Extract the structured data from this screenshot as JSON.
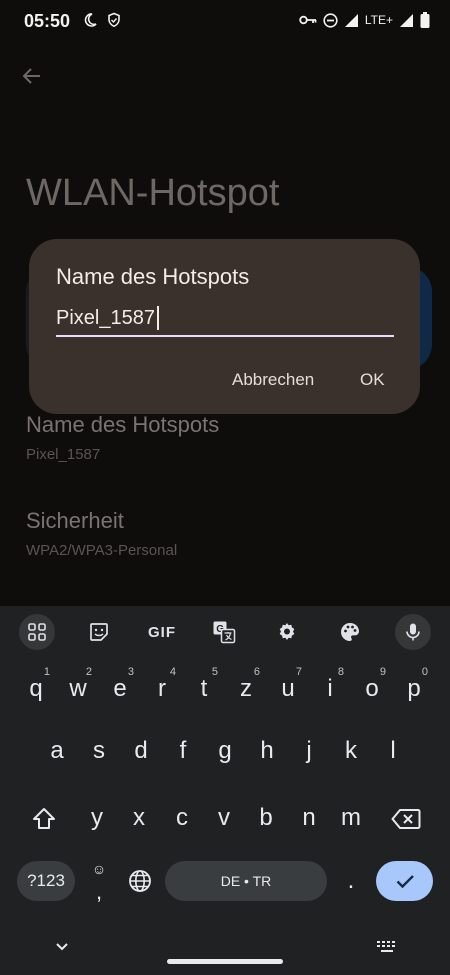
{
  "status": {
    "time": "05:50",
    "network": "LTE+"
  },
  "page": {
    "title": "WLAN-Hotspot",
    "settings": [
      {
        "title": "Name des Hotspots",
        "subtitle": "Pixel_1587"
      },
      {
        "title": "Sicherheit",
        "subtitle": "WPA2/WPA3-Personal"
      }
    ]
  },
  "dialog": {
    "title": "Name des Hotspots",
    "input_value": "Pixel_1587",
    "cancel_label": "Abbrechen",
    "ok_label": "OK"
  },
  "keyboard": {
    "toolbar": {
      "gif_label": "GIF"
    },
    "row1": [
      {
        "label": "q",
        "hint": "1"
      },
      {
        "label": "w",
        "hint": "2"
      },
      {
        "label": "e",
        "hint": "3"
      },
      {
        "label": "r",
        "hint": "4"
      },
      {
        "label": "t",
        "hint": "5"
      },
      {
        "label": "z",
        "hint": "6"
      },
      {
        "label": "u",
        "hint": "7"
      },
      {
        "label": "i",
        "hint": "8"
      },
      {
        "label": "o",
        "hint": "9"
      },
      {
        "label": "p",
        "hint": "0"
      }
    ],
    "row2": [
      "a",
      "s",
      "d",
      "f",
      "g",
      "h",
      "j",
      "k",
      "l"
    ],
    "row3": [
      "y",
      "x",
      "c",
      "v",
      "b",
      "n",
      "m"
    ],
    "bottom": {
      "symbols_label": "?123",
      "emoji_label": "☺",
      "comma_label": ",",
      "space_label": "DE • TR",
      "period_label": "."
    }
  },
  "colors": {
    "dialog_bg": "#3a302c",
    "keyboard_bg": "#1f2123",
    "enter_key": "#a8c7fa",
    "input_underline": "#e4dcff"
  }
}
